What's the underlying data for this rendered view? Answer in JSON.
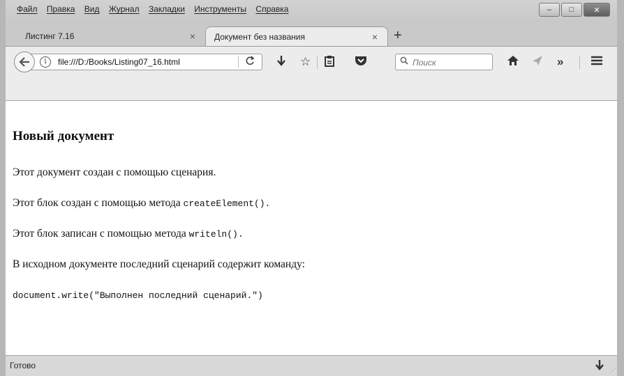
{
  "menu": {
    "items": [
      "Файл",
      "Правка",
      "Вид",
      "Журнал",
      "Закладки",
      "Инструменты",
      "Справка"
    ]
  },
  "window_controls": {
    "minimize": "–",
    "maximize": "□",
    "close": "✕"
  },
  "tabs": [
    {
      "label": "Листинг 7.16",
      "close": "×"
    },
    {
      "label": "Документ без названия",
      "close": "×"
    }
  ],
  "new_tab": "+",
  "navbar": {
    "url": "file:///D:/Books/Listing07_16.html",
    "search_placeholder": "Поиск"
  },
  "icons": {
    "back": "←",
    "info": "i",
    "reload": "C",
    "download": "⬇",
    "bookmark_star": "☆",
    "reading_list": "⎙",
    "pocket": "⬢",
    "search": "🔍",
    "home": "⌂",
    "share": "◃",
    "overflow": "»",
    "menu": "≡"
  },
  "document": {
    "heading": "Новый документ",
    "p1": "Этот документ создан с помощью сценария.",
    "p2_text": "Этот блок создан с помощью метода ",
    "p2_code": "createElement().",
    "p3_text": "Этот блок записан с помощью метода ",
    "p3_code": "writeln().",
    "p4": "В исходном документе последний сценарий содержит команду:",
    "p5_code": "document.write(\"Выполнен последний сценарий.\")"
  },
  "status": {
    "text": "Готово"
  }
}
